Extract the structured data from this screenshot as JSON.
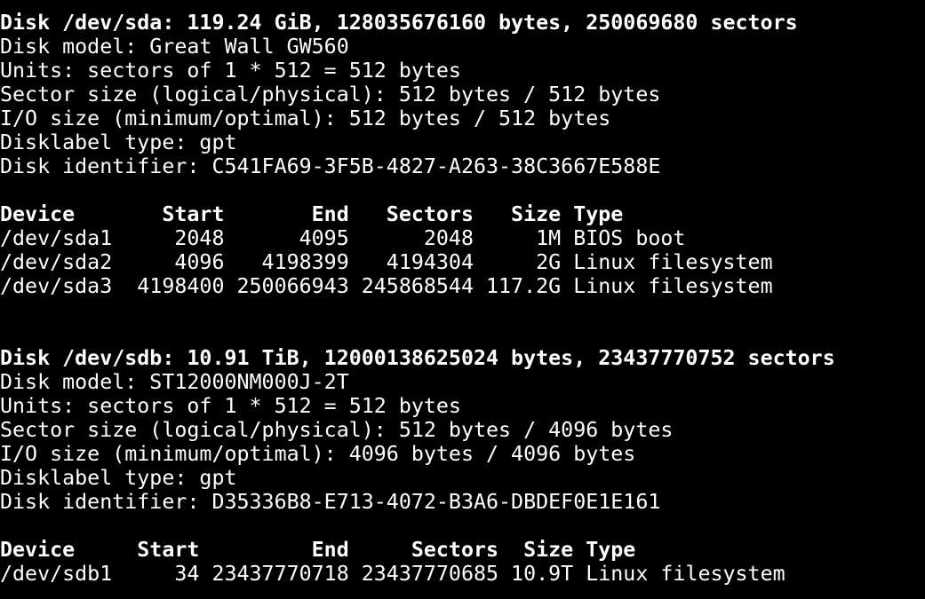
{
  "disks": [
    {
      "header": "Disk /dev/sda: 119.24 GiB, 128035676160 bytes, 250069680 sectors",
      "model": "Disk model: Great Wall GW560",
      "units": "Units: sectors of 1 * 512 = 512 bytes",
      "sector_size": "Sector size (logical/physical): 512 bytes / 512 bytes",
      "io_size": "I/O size (minimum/optimal): 512 bytes / 512 bytes",
      "label_type": "Disklabel type: gpt",
      "identifier": "Disk identifier: C541FA69-3F5B-4827-A263-38C3667E588E",
      "table_header": "Device       Start       End   Sectors   Size Type",
      "partitions": [
        "/dev/sda1     2048      4095      2048     1M BIOS boot",
        "/dev/sda2     4096   4198399   4194304     2G Linux filesystem",
        "/dev/sda3  4198400 250066943 245868544 117.2G Linux filesystem"
      ]
    },
    {
      "header": "Disk /dev/sdb: 10.91 TiB, 12000138625024 bytes, 23437770752 sectors",
      "model": "Disk model: ST12000NM000J-2T",
      "units": "Units: sectors of 1 * 512 = 512 bytes",
      "sector_size": "Sector size (logical/physical): 512 bytes / 4096 bytes",
      "io_size": "I/O size (minimum/optimal): 4096 bytes / 4096 bytes",
      "label_type": "Disklabel type: gpt",
      "identifier": "Disk identifier: D35336B8-E713-4072-B3A6-DBDEF0E1E161",
      "table_header": "Device     Start         End     Sectors  Size Type",
      "partitions": [
        "/dev/sdb1     34 23437770718 23437770685 10.9T Linux filesystem"
      ]
    }
  ]
}
